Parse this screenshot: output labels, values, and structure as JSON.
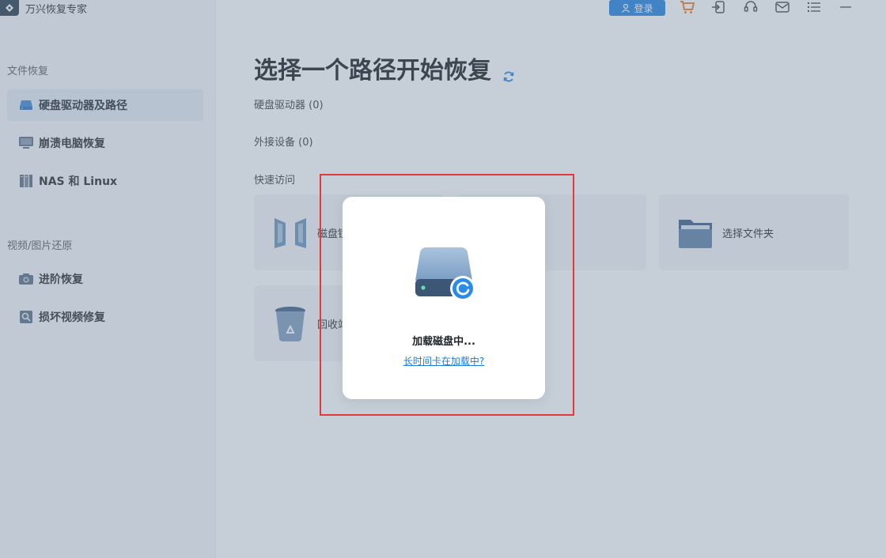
{
  "app": {
    "name": "万兴恢复专家"
  },
  "topbar": {
    "login_label": "登录"
  },
  "sidebar": {
    "sections": [
      {
        "title": "文件恢复"
      },
      {
        "title": "视频/图片还原"
      }
    ],
    "items": [
      {
        "label": "硬盘驱动器及路径",
        "icon": "hard-drive-icon",
        "active": true
      },
      {
        "label": "崩溃电脑恢复",
        "icon": "monitor-icon"
      },
      {
        "label": "NAS 和 Linux",
        "icon": "nas-icon"
      },
      {
        "label": "进阶恢复",
        "icon": "camera-icon"
      },
      {
        "label": "损坏视频修复",
        "icon": "video-repair-icon"
      }
    ]
  },
  "main": {
    "title": "选择一个路径开始恢复",
    "drives_label": "硬盘驱动器",
    "drives_count": "(0)",
    "external_label": "外接设备",
    "external_count": "(0)",
    "quick_access_label": "快速访问",
    "cards": [
      {
        "label": "磁盘镜像",
        "icon": "disk-image-icon"
      },
      {
        "label": "",
        "icon": ""
      },
      {
        "label": "选择文件夹",
        "icon": "folder-icon"
      },
      {
        "label": "回收站",
        "icon": "recycle-bin-icon"
      }
    ]
  },
  "modal": {
    "text": "加载磁盘中...",
    "link": "长时间卡在加载中?"
  },
  "colors": {
    "accent": "#1a7ee0",
    "highlight": "#e23a3a",
    "overlay": "rgba(120,138,160,0.42)"
  }
}
